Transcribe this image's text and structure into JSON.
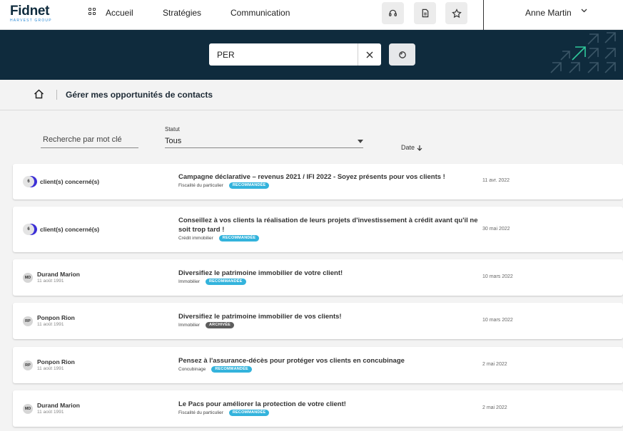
{
  "brand": {
    "name": "Fidnet",
    "sub": "HARVEST GROUP"
  },
  "nav": {
    "home": "Accueil",
    "strategies": "Stratégies",
    "communication": "Communication"
  },
  "user": {
    "name": "Anne Martin"
  },
  "search": {
    "value": "PER"
  },
  "breadcrumb": {
    "title": "Gérer mes opportunités de contacts"
  },
  "filters": {
    "keyword_placeholder": "Recherche par mot clé",
    "status_label": "Statut",
    "status_value": "Tous",
    "date_label": "Date"
  },
  "colors": {
    "navy": "#0f2b3d",
    "tag_recommended": "#33b3dc",
    "tag_archived": "#5d5d5d",
    "count_badge": "#3c2fd6"
  },
  "opportunities": [
    {
      "contact": {
        "type": "count",
        "count": "6",
        "label": "client(s) concerné(s)"
      },
      "title": "Campagne déclarative – revenus 2021 / IFI 2022 - Soyez présents pour vos clients !",
      "category": "Fiscalité du particulier",
      "tag": "RECOMMANDÉE",
      "date": "11 avr. 2022"
    },
    {
      "contact": {
        "type": "count",
        "count": "6",
        "label": "client(s) concerné(s)"
      },
      "title": "Conseillez à vos clients la réalisation de leurs projets d'investissement à crédit avant qu'il ne soit trop tard !",
      "category": "Crédit immobilier",
      "tag": "RECOMMANDÉE",
      "date": "30 mai 2022"
    },
    {
      "contact": {
        "type": "person",
        "initials": "MD",
        "name": "Durand Marion",
        "birth": "11 août 1991"
      },
      "title": "Diversifiez le patrimoine immobilier de votre client!",
      "category": "Immobilier",
      "tag": "RECOMMANDÉE",
      "date": "10 mars 2022"
    },
    {
      "contact": {
        "type": "person",
        "initials": "RP",
        "name": "Ponpon Rion",
        "birth": "11 août 1991"
      },
      "title": "Diversifiez le patrimoine immobilier de vos clients!",
      "category": "Immobilier",
      "tag": "ARCHIVÉE",
      "date": "10 mars 2022"
    },
    {
      "contact": {
        "type": "person",
        "initials": "RP",
        "name": "Ponpon Rion",
        "birth": "11 août 1991"
      },
      "title": "Pensez à l'assurance-décès pour protéger vos clients en concubinage",
      "category": "Concubinage",
      "tag": "RECOMMANDÉE",
      "date": "2 mai 2022"
    },
    {
      "contact": {
        "type": "person",
        "initials": "MD",
        "name": "Durand Marion",
        "birth": "11 août 1991"
      },
      "title": "Le Pacs pour améliorer la protection de votre client!",
      "category": "Fiscalité du particulier",
      "tag": "RECOMMANDÉE",
      "date": "2 mai 2022"
    }
  ]
}
